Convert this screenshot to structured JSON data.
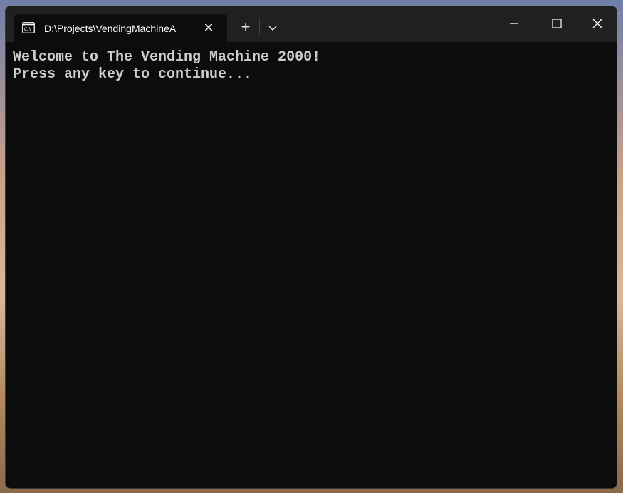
{
  "tab": {
    "title": "D:\\Projects\\VendingMachineA",
    "icon": "command-prompt-icon"
  },
  "titlebar": {
    "new_tab_label": "+",
    "close_tab_label": "✕"
  },
  "terminal": {
    "lines": [
      "Welcome to The Vending Machine 2000!",
      "Press any key to continue..."
    ]
  },
  "colors": {
    "terminal_bg": "#0c0c0c",
    "titlebar_bg": "#202020",
    "text": "#cccccc"
  }
}
